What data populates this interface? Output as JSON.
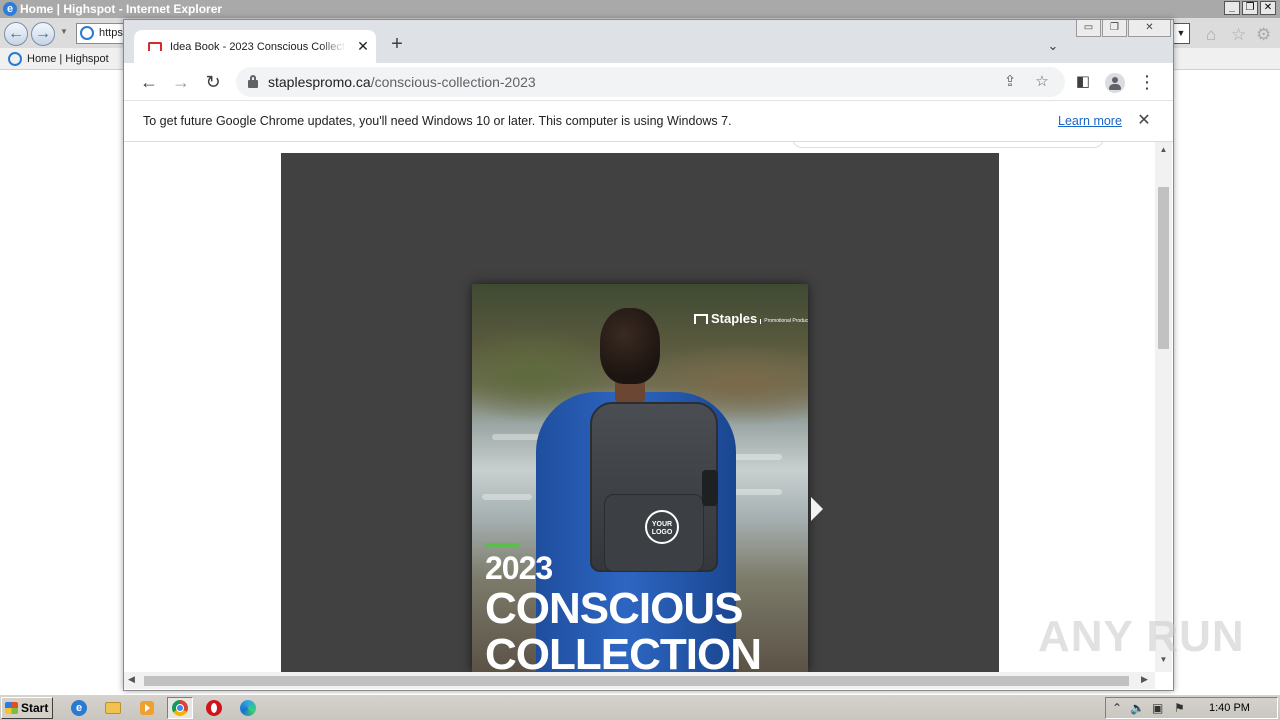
{
  "ie": {
    "title": "Home | Highspot - Internet Explorer",
    "address_value": "https",
    "favorite_item": "Home | Highspot"
  },
  "chrome": {
    "tab_title": "Idea Book - 2023 Conscious Collection",
    "url_domain": "staplespromo.ca",
    "url_path": "/conscious-collection-2023",
    "infobar_message": "To get future Google Chrome updates, you'll need Windows 10 or later. This computer is using Windows 7.",
    "infobar_link": "Learn more"
  },
  "catalog": {
    "brand": "Staples",
    "brand_sub": "Promotional Products",
    "logo_placeholder": "YOUR LOGO",
    "year": "2023",
    "title": "CONSCIOUS\nCOLLECTION"
  },
  "taskbar": {
    "start_label": "Start",
    "clock": "1:40 PM"
  },
  "watermark": "ANY RUN",
  "colors": {
    "chrome_tabstrip": "#dee1e6",
    "viewer_background": "#414141",
    "accent_green": "#5bbd4c",
    "link_blue": "#1a66c8"
  }
}
